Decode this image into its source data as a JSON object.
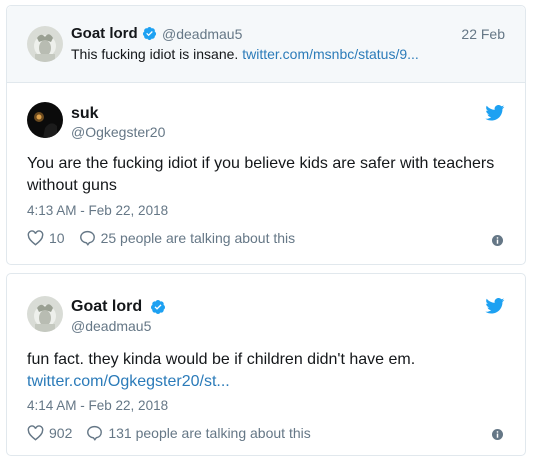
{
  "quoted_tweet": {
    "display_name": "Goat lord",
    "handle": "@deadmau5",
    "date": "22 Feb",
    "text": "This fucking idiot is insane.",
    "link": "twitter.com/msnbc/status/9..."
  },
  "tweet1": {
    "display_name": "suk",
    "handle": "@Ogkegster20",
    "text": "You are the fucking idiot if you believe kids are safer with teachers without guns",
    "timestamp": "4:13 AM - Feb 22, 2018",
    "likes": "10",
    "talking": "25 people are talking about this"
  },
  "tweet2": {
    "display_name": "Goat lord",
    "handle": "@deadmau5",
    "text": "fun fact.  they kinda would be if children didn't have em.",
    "link": "twitter.com/Ogkegster20/st...",
    "timestamp": "4:14 AM - Feb 22, 2018",
    "likes": "902",
    "talking": "131 people are talking about this"
  },
  "colors": {
    "twitter_blue": "#1da1f2",
    "link_blue": "#2b7bb9",
    "muted_gray": "#657786",
    "quote_background": "#f5f8fa"
  }
}
